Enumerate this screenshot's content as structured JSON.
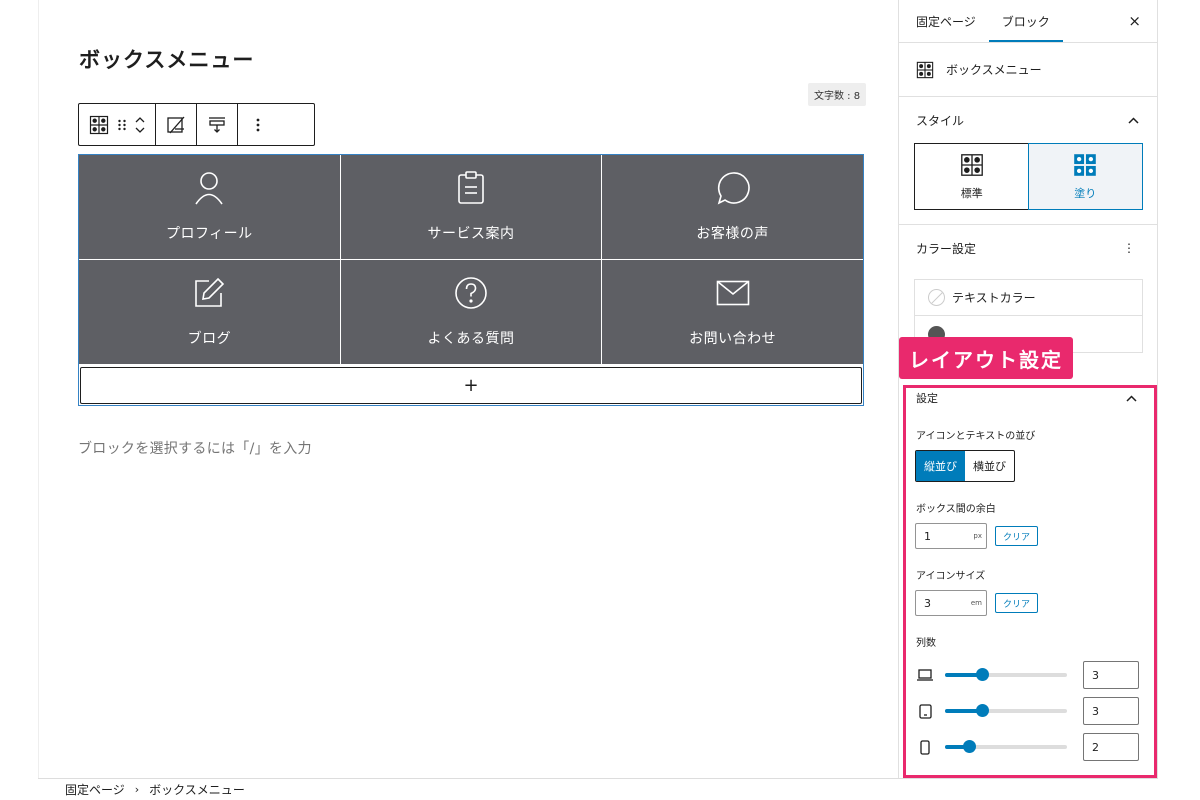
{
  "editor": {
    "page_title": "ボックスメニュー",
    "char_count": "文字数 : 8",
    "placeholder": "ブロックを選択するには「/」を入力",
    "add_label": "+"
  },
  "toolbar": {
    "icons": [
      "box-menu-icon",
      "drag-handle-icon",
      "move-up-down-icon",
      "change-style-icon",
      "align-icon",
      "more-options-icon"
    ]
  },
  "box_menu": {
    "items": [
      {
        "label": "プロフィール",
        "icon": "person-icon"
      },
      {
        "label": "サービス案内",
        "icon": "clipboard-icon"
      },
      {
        "label": "お客様の声",
        "icon": "speech-bubble-icon"
      },
      {
        "label": "ブログ",
        "icon": "edit-icon"
      },
      {
        "label": "よくある質問",
        "icon": "question-icon"
      },
      {
        "label": "お問い合わせ",
        "icon": "mail-icon"
      }
    ],
    "cell_color": "#5e5f64"
  },
  "footer": {
    "breadcrumb": [
      "固定ページ",
      "ボックスメニュー"
    ],
    "separator": "›"
  },
  "sidebar": {
    "tabs": [
      "固定ページ",
      "ブロック"
    ],
    "active_tab": "ブロック",
    "close": "×",
    "block_name": "ボックスメニュー",
    "style": {
      "title": "スタイル",
      "options": [
        "標準",
        "塗り"
      ],
      "selected": "塗り"
    },
    "color": {
      "title": "カラー設定",
      "more": "⋮",
      "items": [
        "テキストカラー"
      ]
    },
    "callout": "レイアウト設定",
    "settings": {
      "title": "設定",
      "arrangement_label": "アイコンとテキストの並び",
      "arrangement_options": [
        "縦並び",
        "横並び"
      ],
      "arrangement_selected": "縦並び",
      "gap_label": "ボックス間の余白",
      "gap_value": "1",
      "gap_unit": "px",
      "icon_size_label": "アイコンサイズ",
      "icon_size_value": "3",
      "icon_size_unit": "em",
      "clear_label": "クリア",
      "columns_label": "列数",
      "columns": [
        {
          "device": "desktop-icon",
          "value": "3",
          "level": 3,
          "max": 10
        },
        {
          "device": "tablet-icon",
          "value": "3",
          "level": 3,
          "max": 10
        },
        {
          "device": "mobile-icon",
          "value": "2",
          "level": 2,
          "max": 10
        }
      ]
    }
  },
  "colors": {
    "accent": "#007cba",
    "highlight": "#e9296d"
  }
}
